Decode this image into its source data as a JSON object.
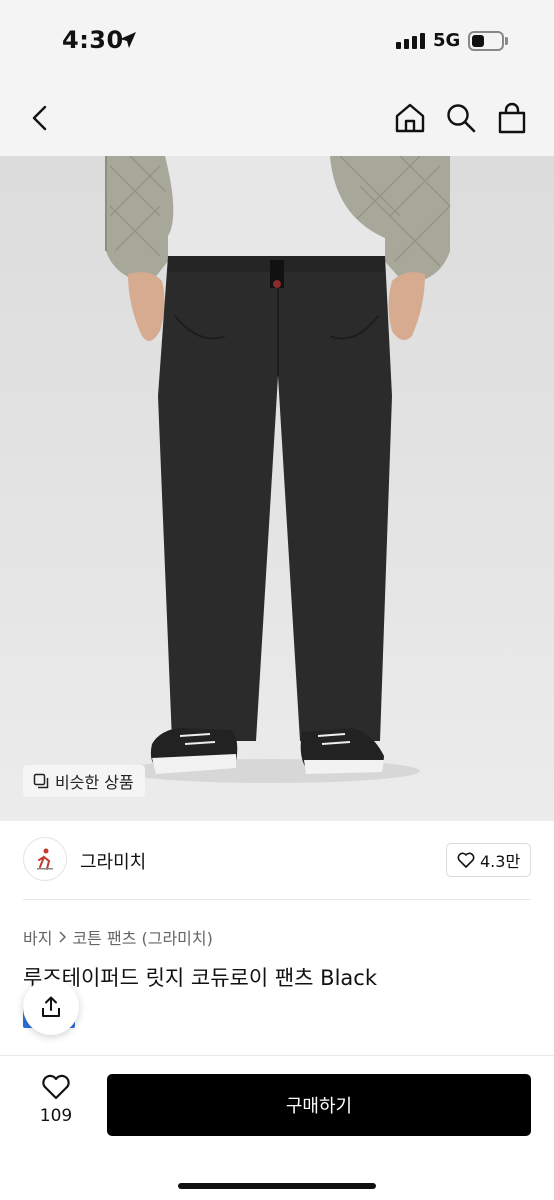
{
  "status_bar": {
    "time": "4:30",
    "network": "5G"
  },
  "nav": {
    "back_icon": "chevron-left-icon",
    "home_icon": "home-icon",
    "search_icon": "search-icon",
    "bag_icon": "shopping-bag-icon"
  },
  "image": {
    "similar_label": "비슷한 상품"
  },
  "brand": {
    "name": "그라미치",
    "likes": "4.3만"
  },
  "breadcrumb": {
    "level1": "바지",
    "level2": "코튼 팬츠 (그라미치)"
  },
  "product": {
    "title": "루즈테이퍼드 릿지 코듀로이 팬츠 Black"
  },
  "bottom": {
    "wish_count": "109",
    "buy_label": "구매하기"
  },
  "colors": {
    "accent": "#000000",
    "tag_blue": "#2f6fe0"
  }
}
